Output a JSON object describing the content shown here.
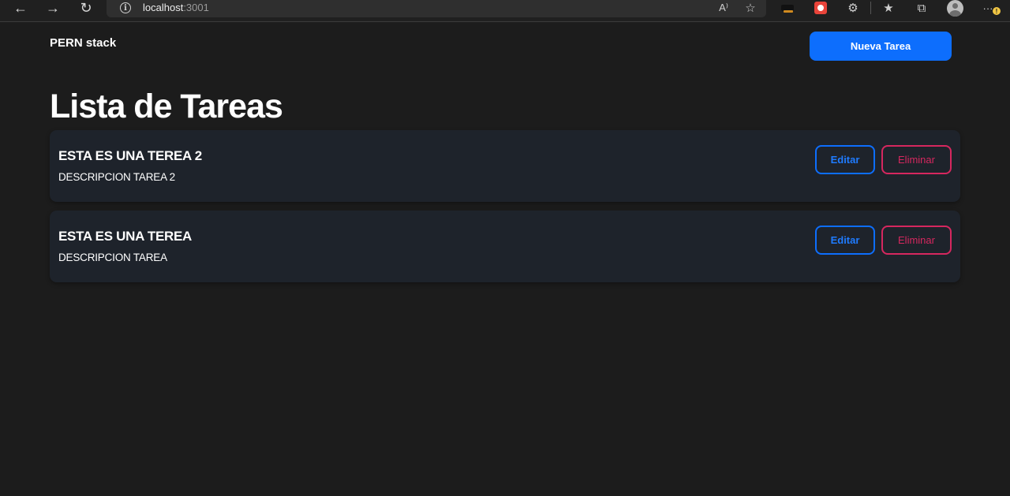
{
  "browser": {
    "url_host": "localhost",
    "url_port": ":3001",
    "nav": {
      "back_icon": "arrow-left-icon",
      "forward_icon": "arrow-right-icon",
      "refresh_icon": "refresh-icon"
    },
    "toolbar_icons": [
      "read-aloud-icon",
      "add-favorite-icon",
      "extensions-icon",
      "favorites-icon",
      "collections-icon",
      "profile-icon",
      "more-icon"
    ],
    "read_aloud_glyph": "A⁾",
    "more_glyph": "···",
    "warning_glyph": "!"
  },
  "app": {
    "brand": "PERN stack",
    "new_task_label": "Nueva Tarea",
    "page_title": "Lista de Tareas",
    "tasks": [
      {
        "title": "ESTA ES UNA TEREA 2",
        "description": "DESCRIPCION TAREA 2",
        "edit_label": "Editar",
        "delete_label": "Eliminar"
      },
      {
        "title": "ESTA ES UNA TEREA",
        "description": "DESCRIPCION TAREA",
        "edit_label": "Editar",
        "delete_label": "Eliminar"
      }
    ]
  },
  "colors": {
    "background": "#1c1c1c",
    "card": "#1e232b",
    "primary": "#0d6efd",
    "danger": "#d6275f"
  }
}
